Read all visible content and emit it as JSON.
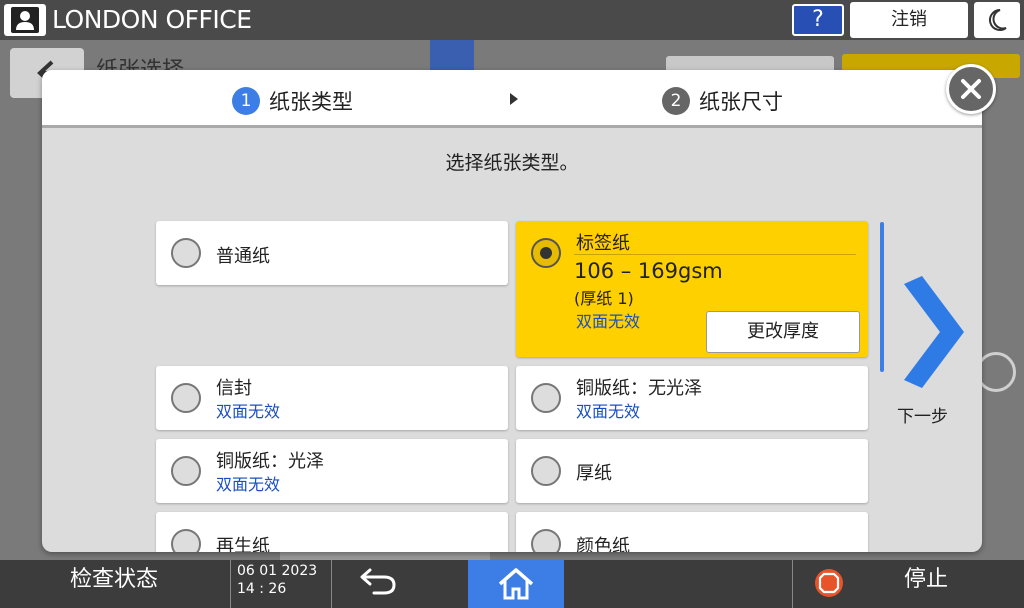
{
  "topbar": {
    "office_name": "LONDON OFFICE",
    "help_label": "?",
    "logout_label": "注销"
  },
  "background": {
    "title": "纸张选择"
  },
  "wizard": {
    "steps": [
      {
        "num": "1",
        "label": "纸张类型"
      },
      {
        "num": "2",
        "label": "纸张尺寸"
      }
    ],
    "instruction": "选择纸张类型。",
    "options": [
      {
        "label": "普通纸",
        "sub": ""
      },
      {
        "label": "标签纸",
        "sub": "双面无效",
        "gsm": "106 – 169gsm",
        "thickness": "(厚纸 1)",
        "selected": true
      },
      {
        "label": "信封",
        "sub": "双面无效"
      },
      {
        "label": "铜版纸：无光泽",
        "sub": "双面无效"
      },
      {
        "label": "铜版纸：光泽",
        "sub": "双面无效"
      },
      {
        "label": "厚纸",
        "sub": ""
      },
      {
        "label": "再生纸",
        "sub": ""
      },
      {
        "label": "颜色纸",
        "sub": ""
      }
    ],
    "change_thickness_label": "更改厚度",
    "next_label": "下一步"
  },
  "bottombar": {
    "check_status": "检查状态",
    "date": "06 01 2023",
    "time": "14 : 26",
    "stop_label": "停止"
  },
  "colors": {
    "accent_blue": "#3d7ee6",
    "selected_yellow": "#ffd000",
    "subtext_blue": "#1a4fc0",
    "stop_orange": "#e8542a"
  }
}
